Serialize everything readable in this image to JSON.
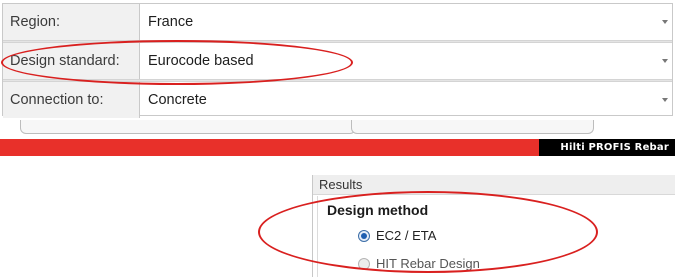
{
  "form": {
    "rows": [
      {
        "label": "Region:",
        "value": "France"
      },
      {
        "label": "Design standard:",
        "value": "Eurocode based"
      },
      {
        "label": "Connection to:",
        "value": "Concrete"
      }
    ]
  },
  "app": {
    "brand": "Hilti PROFIS Rebar",
    "accent_color": "#e8302a"
  },
  "results": {
    "header": "Results",
    "design_method": {
      "title": "Design method",
      "options": [
        {
          "label": "EC2 / ETA",
          "selected": true
        },
        {
          "label": "HIT Rebar Design",
          "selected": false
        }
      ]
    }
  },
  "highlight_color": "#d9201f"
}
